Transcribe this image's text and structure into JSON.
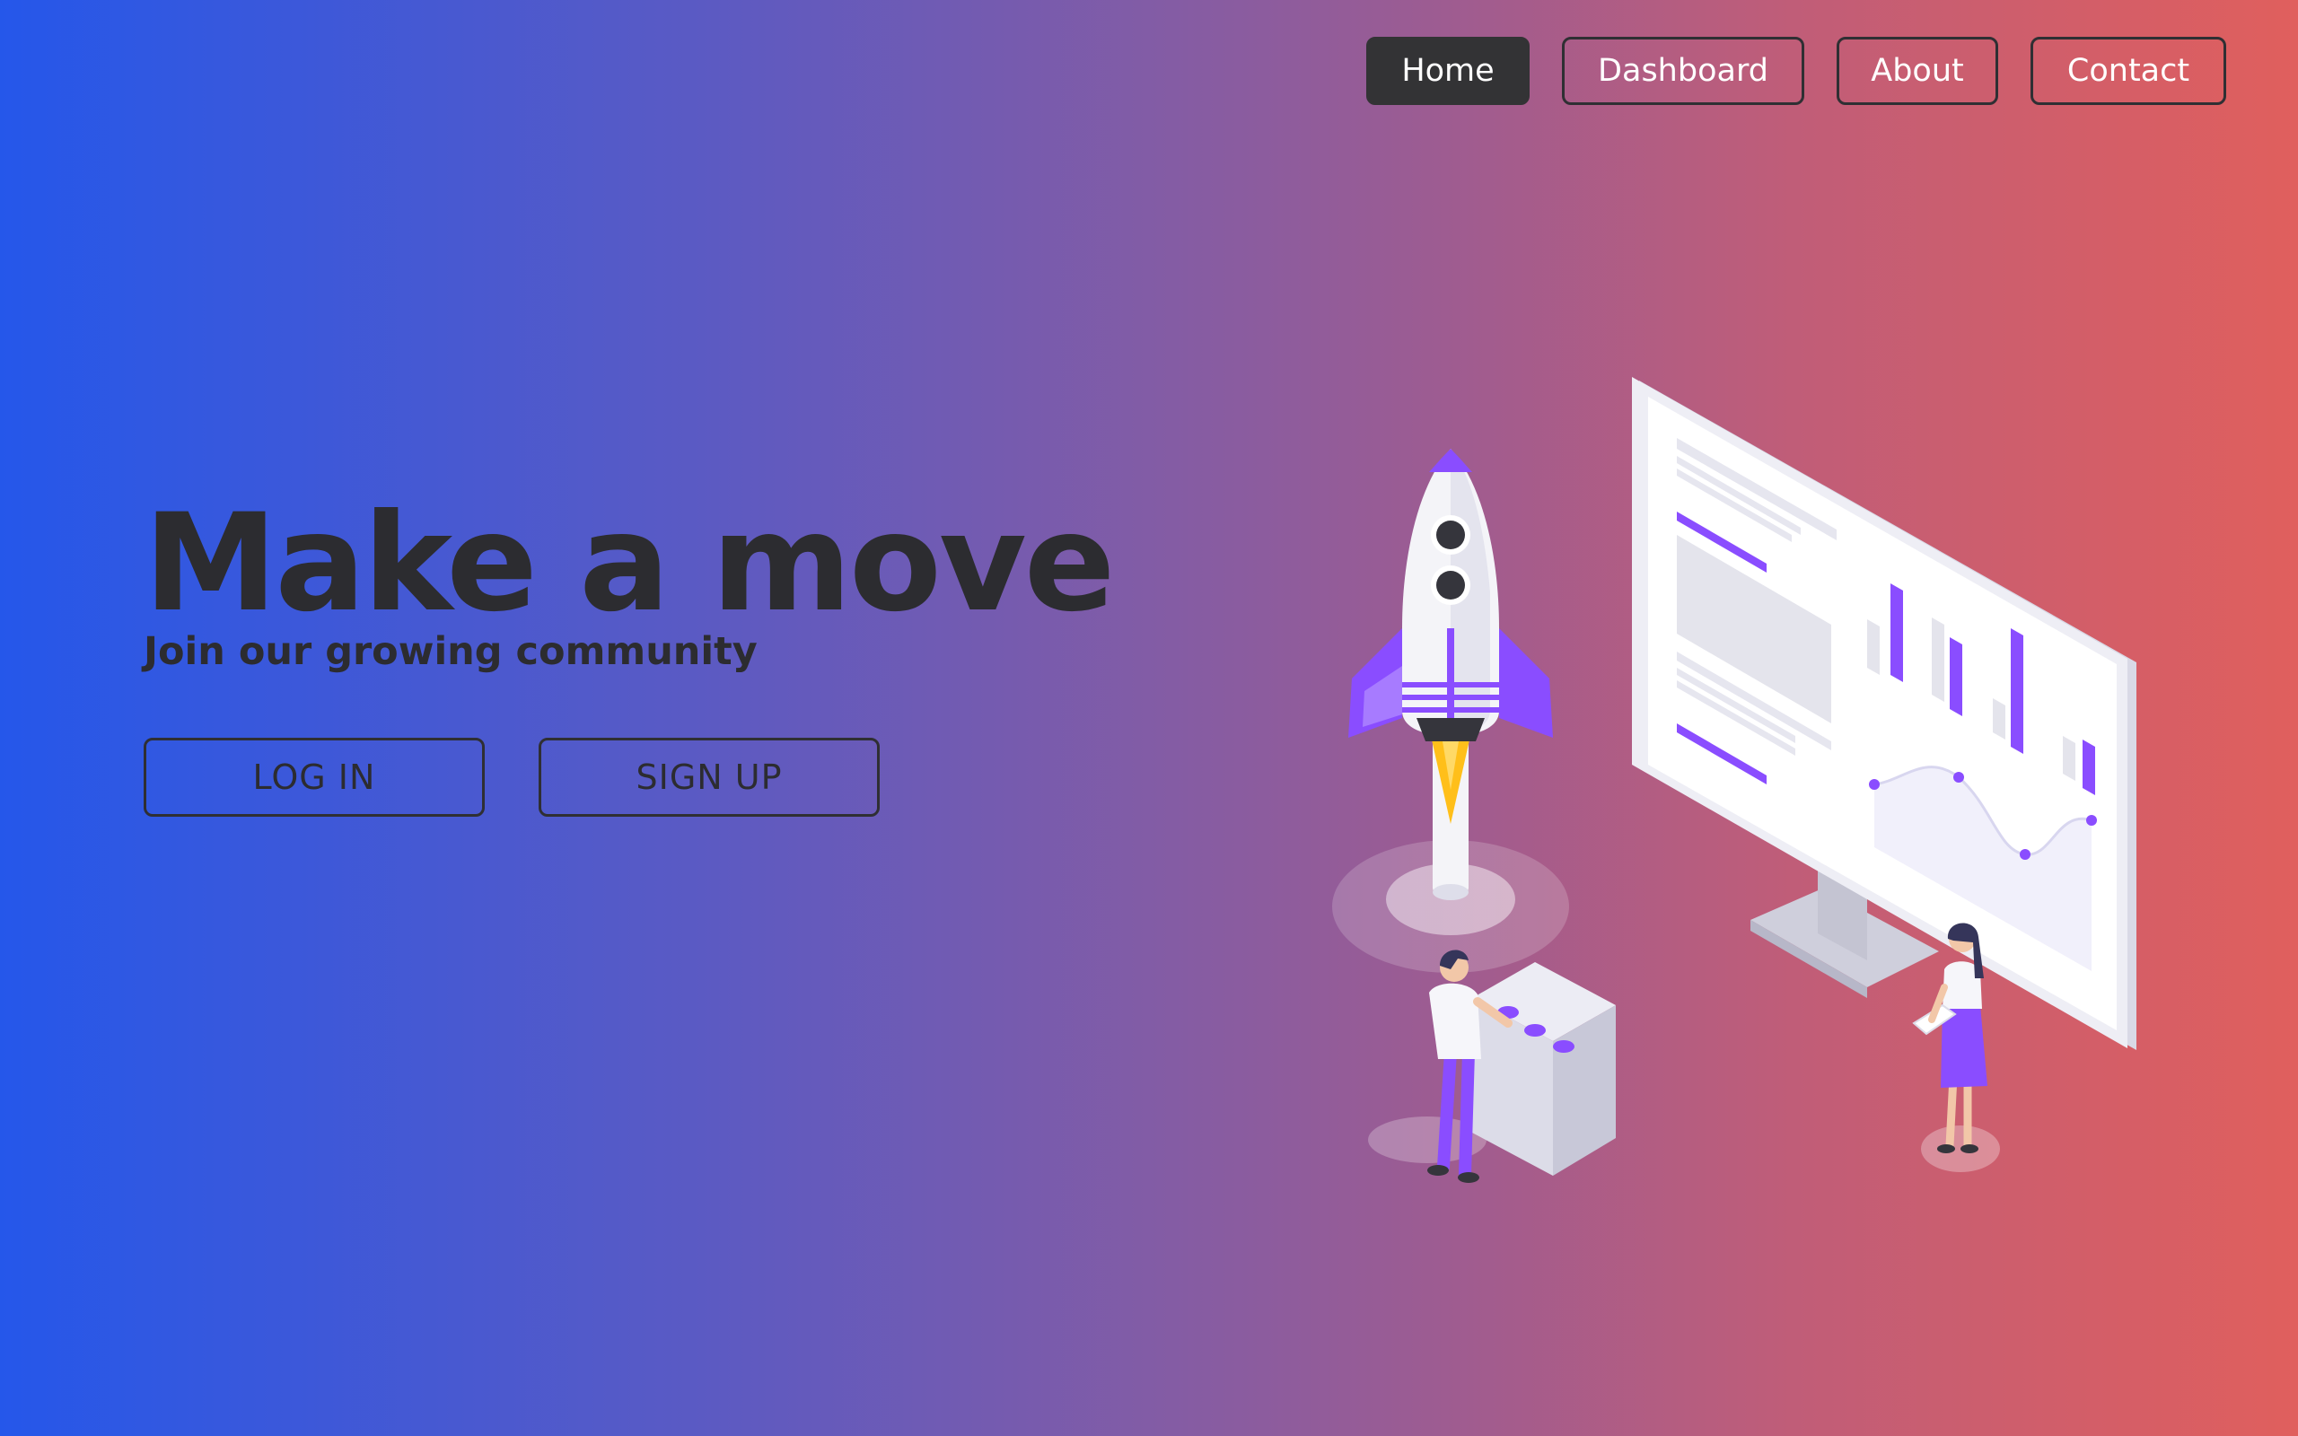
{
  "nav": {
    "items": [
      {
        "label": "Home",
        "active": true
      },
      {
        "label": "Dashboard",
        "active": false
      },
      {
        "label": "About",
        "active": false
      },
      {
        "label": "Contact",
        "active": false
      }
    ]
  },
  "hero": {
    "title": "Make a move",
    "subtitle": "Join our growing community"
  },
  "cta": {
    "login_label": "LOG IN",
    "signup_label": "SIGN UP"
  },
  "illustration": {
    "icons": [
      "rocket-icon",
      "monitor-icon",
      "control-panel-icon",
      "man-figure-icon",
      "woman-figure-icon"
    ],
    "accent_color": "#8a4dff",
    "flame_color": "#ffbf1a"
  },
  "theme": {
    "gradient_start": "#2557ea",
    "gradient_end": "#e05f5d",
    "text_dark": "#2c2c30"
  }
}
